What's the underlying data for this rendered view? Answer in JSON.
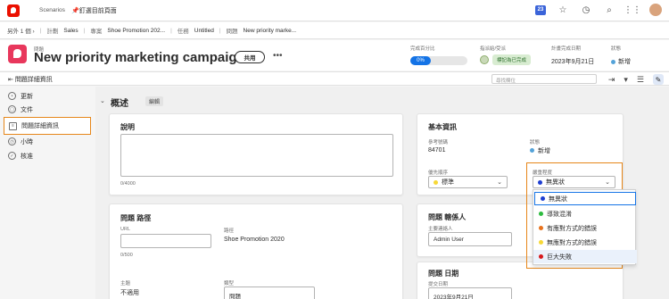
{
  "topbar": {
    "scenarios": "Scenarios",
    "pin_label": "釘選目前頁面",
    "notification_count": "23"
  },
  "breadcrumb": {
    "items": [
      "另外 1 個 ›",
      "計劃",
      "Sales",
      "專案",
      "Shoe Promotion 202...",
      "任務",
      "Untitled",
      "問題",
      "New priority marke..."
    ]
  },
  "header": {
    "object_type": "問題",
    "title": "New priority marketing campaign",
    "share_label": "共用",
    "more_label": "•••",
    "percent_label": "完成百分比",
    "percent_value": "0%",
    "percent_fraction": 0.05,
    "owner_label": "指派給/受派",
    "owner_status": "標記為已完成",
    "due_label": "計畫完成日期",
    "due_value": "2023年9月21日",
    "status_label": "狀態",
    "status_value": "新增",
    "status_color": "#54a3d9"
  },
  "subbar": {
    "back_label": "問題詳細資訊",
    "search_placeholder": "尋找欄位"
  },
  "nav": {
    "items": [
      {
        "label": "更新",
        "icon": "updates-icon"
      },
      {
        "label": "文件",
        "icon": "documents-icon"
      },
      {
        "label": "問題詳細資訊",
        "icon": "details-icon"
      },
      {
        "label": "小時",
        "icon": "hours-icon"
      },
      {
        "label": "核准",
        "icon": "approvals-icon"
      }
    ],
    "active_index": 2
  },
  "section": {
    "title": "概述",
    "edit_label": "編輯"
  },
  "description_card": {
    "title": "說明",
    "counter": "0/4000"
  },
  "path_card": {
    "title": "問題 路徑",
    "url_label": "URL",
    "url_counter": "0/500",
    "path_label": "路徑",
    "path_value": "Shoe Promotion 2020",
    "topic_label": "主題",
    "topic_value": "不適用",
    "type_label": "類型",
    "type_value": "問題"
  },
  "basic_card": {
    "title": "基本資訊",
    "ref_label": "參考號碼",
    "ref_value": "84701",
    "status_label": "狀態",
    "status_value": "新增",
    "priority_label": "優先順序",
    "priority_value": "標準",
    "priority_color": "#f7d836",
    "severity_label": "嚴重程度",
    "severity_value": "無異狀",
    "severity_color": "#1d3ed1"
  },
  "people_card": {
    "title": "問題 轄係人",
    "requester_label": "主要連絡人",
    "requester_value": "Admin User"
  },
  "date_card": {
    "title": "問題 日期",
    "entry_label": "提交日期",
    "entry_value": "2023年9月21日"
  },
  "severity_options": [
    {
      "label": "無異狀",
      "color": "#1d3ed1"
    },
    {
      "label": "導致混淆",
      "color": "#2dbb3f"
    },
    {
      "label": "有應對方式的錯誤",
      "color": "#e8721c"
    },
    {
      "label": "無應對方式的錯誤",
      "color": "#f7d836"
    },
    {
      "label": "巨大失敗",
      "color": "#d7191c"
    }
  ]
}
